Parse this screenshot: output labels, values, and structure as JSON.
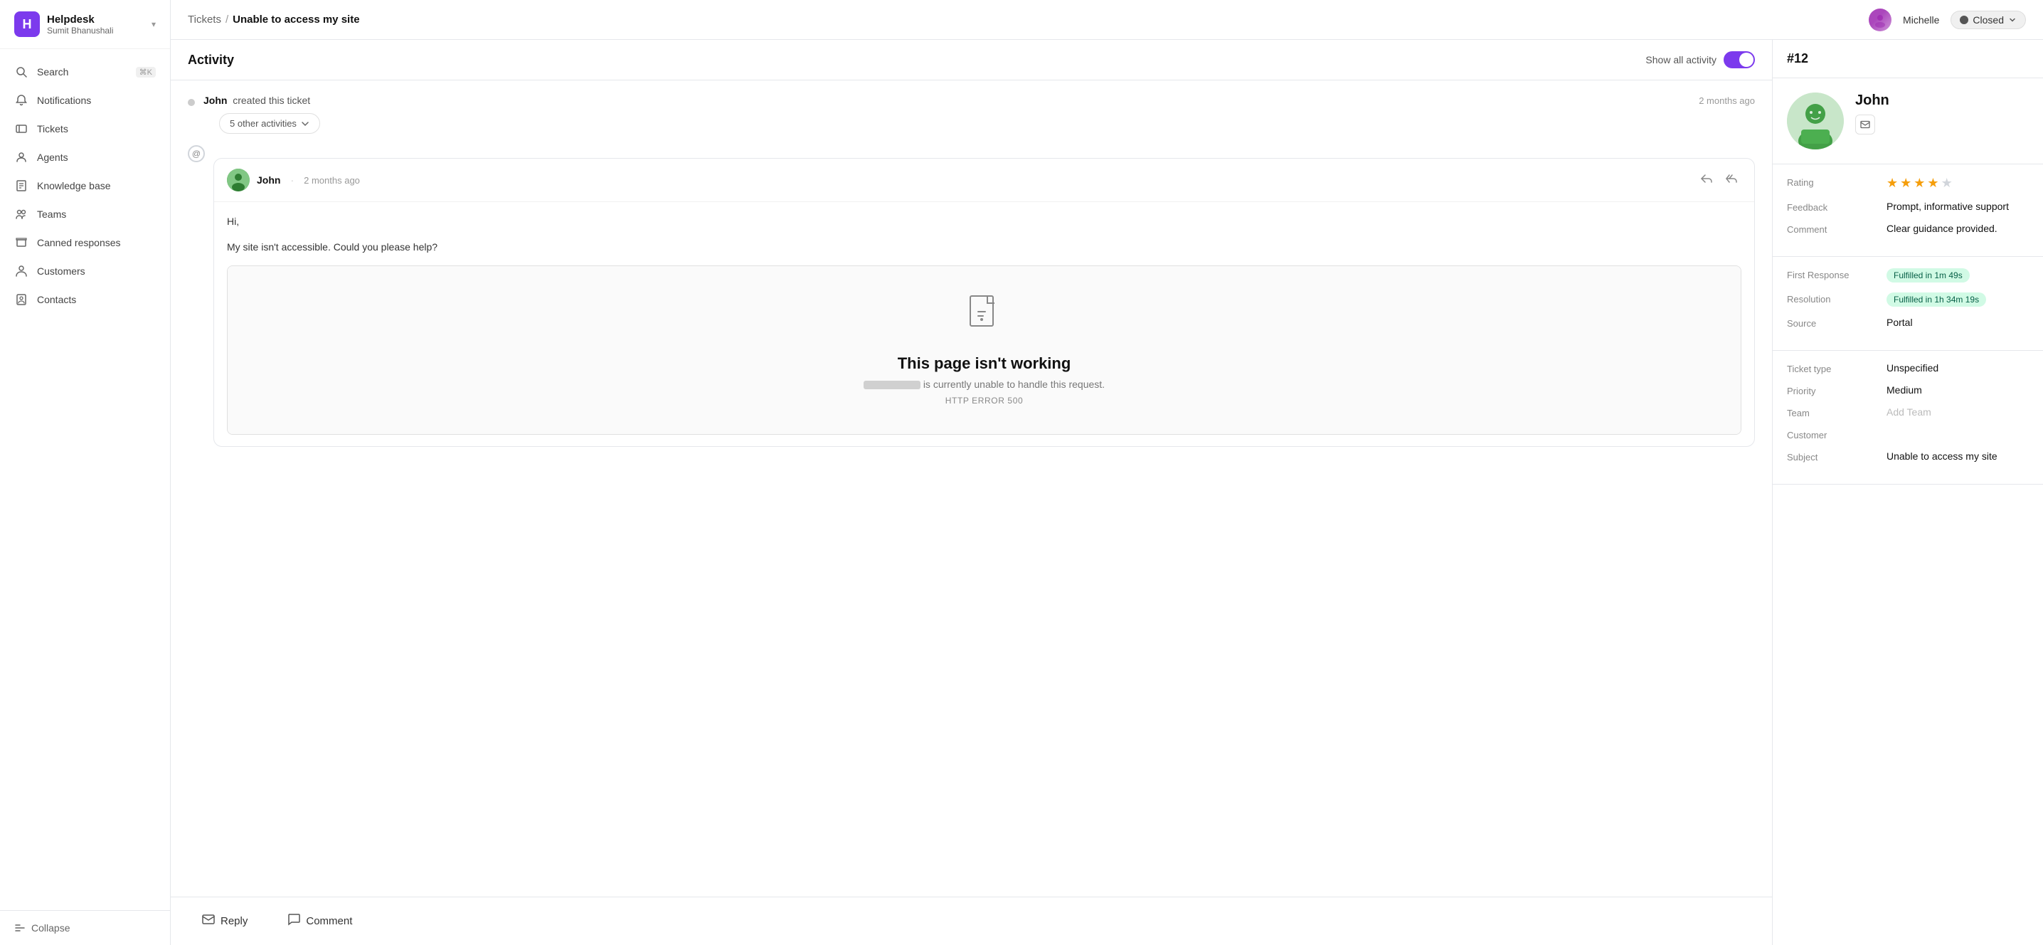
{
  "sidebar": {
    "brand": {
      "icon": "H",
      "name": "Helpdesk",
      "user": "Sumit Bhanushali"
    },
    "nav": [
      {
        "id": "search",
        "label": "Search",
        "icon": "search",
        "kbd": "⌘K"
      },
      {
        "id": "notifications",
        "label": "Notifications",
        "icon": "bell",
        "kbd": null
      },
      {
        "id": "tickets",
        "label": "Tickets",
        "icon": "ticket",
        "kbd": null
      },
      {
        "id": "agents",
        "label": "Agents",
        "icon": "person",
        "kbd": null
      },
      {
        "id": "knowledge-base",
        "label": "Knowledge base",
        "icon": "book",
        "kbd": null
      },
      {
        "id": "teams",
        "label": "Teams",
        "icon": "team",
        "kbd": null
      },
      {
        "id": "canned-responses",
        "label": "Canned responses",
        "icon": "canned",
        "kbd": null
      },
      {
        "id": "customers",
        "label": "Customers",
        "icon": "customers",
        "kbd": null
      },
      {
        "id": "contacts",
        "label": "Contacts",
        "icon": "contacts",
        "kbd": null
      }
    ],
    "footer": {
      "collapse_label": "Collapse"
    }
  },
  "topbar": {
    "breadcrumb": {
      "tickets": "Tickets",
      "separator": "/",
      "current": "Unable to access my site"
    },
    "user": {
      "name": "Michelle"
    },
    "status": {
      "label": "Closed"
    }
  },
  "activity": {
    "title": "Activity",
    "show_all_label": "Show all activity",
    "created_event": {
      "actor": "John",
      "action": "created this ticket",
      "time": "2 months ago"
    },
    "other_activities": {
      "label": "5 other activities"
    },
    "message": {
      "sender": "John",
      "time": "2 months ago",
      "body_line1": "Hi,",
      "body_line2": "My site isn't accessible. Could you please help?",
      "embedded": {
        "title": "This page isn't working",
        "subtitle_suffix": "is currently unable to handle this request.",
        "error_code": "HTTP ERROR 500"
      }
    }
  },
  "bottom_bar": {
    "reply_label": "Reply",
    "comment_label": "Comment"
  },
  "right_panel": {
    "ticket_id": "#12",
    "customer": {
      "name": "John"
    },
    "rating": {
      "label": "Rating",
      "value": 4,
      "max": 5
    },
    "feedback": {
      "label": "Feedback",
      "value": "Prompt, informative support"
    },
    "comment": {
      "label": "Comment",
      "value": "Clear guidance provided."
    },
    "first_response": {
      "label": "First Response",
      "value": "Fulfilled in 1m 49s"
    },
    "resolution": {
      "label": "Resolution",
      "value": "Fulfilled in 1h 34m 19s"
    },
    "source": {
      "label": "Source",
      "value": "Portal"
    },
    "ticket_type": {
      "label": "Ticket type",
      "value": "Unspecified"
    },
    "priority": {
      "label": "Priority",
      "value": "Medium"
    },
    "team": {
      "label": "Team",
      "placeholder": "Add Team"
    },
    "customer_label": {
      "label": "Customer"
    },
    "subject": {
      "label": "Subject",
      "value": "Unable to access my site"
    }
  }
}
